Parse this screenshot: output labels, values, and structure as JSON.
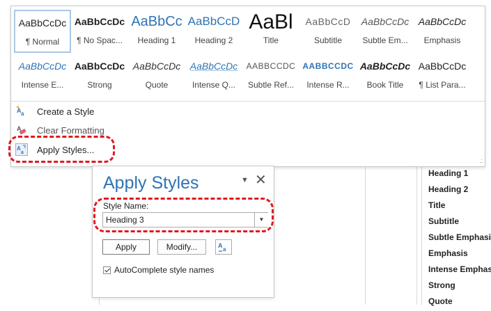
{
  "gallery": {
    "row1": [
      {
        "sample": "AaBbCcDc",
        "label": "¶ Normal",
        "selected": true
      },
      {
        "sample": "AaBbCcDc",
        "label": "¶ No Spac..."
      },
      {
        "sample": "AaBbCc",
        "label": "Heading 1"
      },
      {
        "sample": "AaBbCcD",
        "label": "Heading 2"
      },
      {
        "sample": "AaBl",
        "label": "Title"
      },
      {
        "sample": "AaBbCcD",
        "label": "Subtitle"
      },
      {
        "sample": "AaBbCcDc",
        "label": "Subtle Em..."
      },
      {
        "sample": "AaBbCcDc",
        "label": "Emphasis"
      }
    ],
    "row2": [
      {
        "sample": "AaBbCcDc",
        "label": "Intense E..."
      },
      {
        "sample": "AaBbCcDc",
        "label": "Strong"
      },
      {
        "sample": "AaBbCcDc",
        "label": "Quote"
      },
      {
        "sample": "AaBbCcDc",
        "label": "Intense Q..."
      },
      {
        "sample": "AABBCCDC",
        "label": "Subtle Ref..."
      },
      {
        "sample": "AABBCCDC",
        "label": "Intense R..."
      },
      {
        "sample": "AaBbCcDc",
        "label": "Book Title"
      },
      {
        "sample": "AaBbCcDc",
        "label": "¶ List Para..."
      }
    ],
    "menu": {
      "create_style": "Create a Style",
      "clear_formatting": "Clear Formatting",
      "apply_styles": "Apply Styles..."
    }
  },
  "pane": {
    "title": "Apply Styles",
    "style_name_label": "Style Name:",
    "style_name_value": "Heading 3",
    "apply_button": "Apply",
    "modify_button": "Modify...",
    "autocomplete_label": "AutoComplete style names",
    "autocomplete_checked": true
  },
  "background_style_list": [
    "Heading 1",
    "Heading 2",
    "Title",
    "Subtitle",
    "Subtle Emphasis",
    "Emphasis",
    "Intense Emphasis",
    "Strong",
    "Quote"
  ],
  "colors": {
    "accent_blue": "#2e74b5",
    "annotation_red": "#e0191f"
  }
}
